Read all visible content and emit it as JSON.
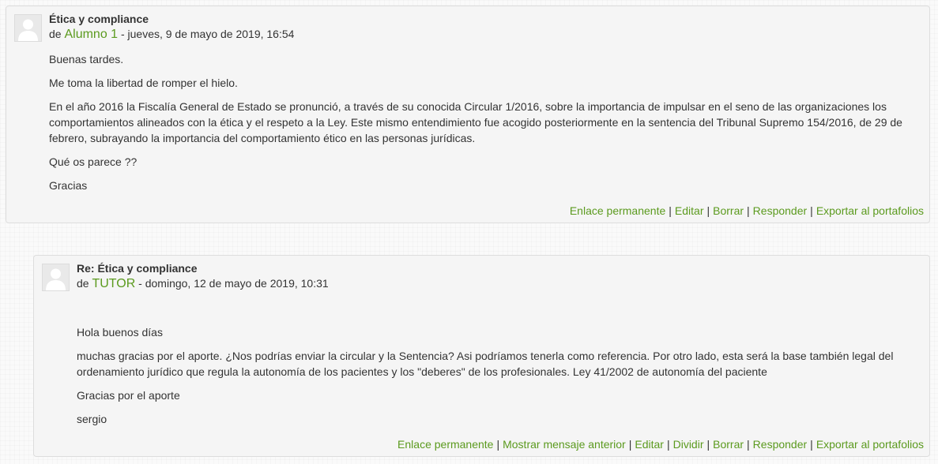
{
  "posts": [
    {
      "subject": "Ética y compliance",
      "by_prefix": "de",
      "author": "Alumno 1",
      "date": "- jueves, 9 de mayo de 2019, 16:54",
      "paragraphs": [
        "Buenas tardes.",
        "Me toma la libertad de romper el hielo.",
        "En el año 2016 la Fiscalía General de Estado se pronunció, a través de su conocida Circular 1/2016, sobre la importancia de impulsar en el seno de las organizaciones los comportamientos alineados con la ética y el respeto a la Ley. Este mismo entendimiento fue acogido posteriormente en la sentencia del Tribunal Supremo 154/2016, de 29 de febrero, subrayando la importancia del comportamiento ético en las personas jurídicas.",
        "Qué os parece ??",
        "Gracias"
      ],
      "commands": [
        "Enlace permanente",
        "Editar",
        "Borrar",
        "Responder",
        "Exportar al portafolios"
      ]
    },
    {
      "subject": "Re: Ética y compliance",
      "by_prefix": "de",
      "author": "TUTOR",
      "date": "- domingo, 12 de mayo de 2019, 10:31",
      "paragraphs": [
        "Hola buenos días",
        "muchas gracias por el aporte. ¿Nos podrías enviar la circular y la Sentencia? Asi podríamos tenerla como referencia. Por otro lado, esta será la base también legal del ordenamiento jurídico que regula la autonomía de los pacientes y los \"deberes\" de los profesionales. Ley 41/2002 de autonomía del paciente",
        "Gracias por el aporte",
        "sergio"
      ],
      "commands": [
        "Enlace permanente",
        "Mostrar mensaje anterior",
        "Editar",
        "Dividir",
        "Borrar",
        "Responder",
        "Exportar al portafolios"
      ]
    }
  ],
  "colors": {
    "link": "#5b9a1e",
    "text": "#333333",
    "post_background": "#f5f5f5",
    "post_border": "#dddddd"
  },
  "icons": {
    "avatar": "default-user-avatar-icon"
  }
}
